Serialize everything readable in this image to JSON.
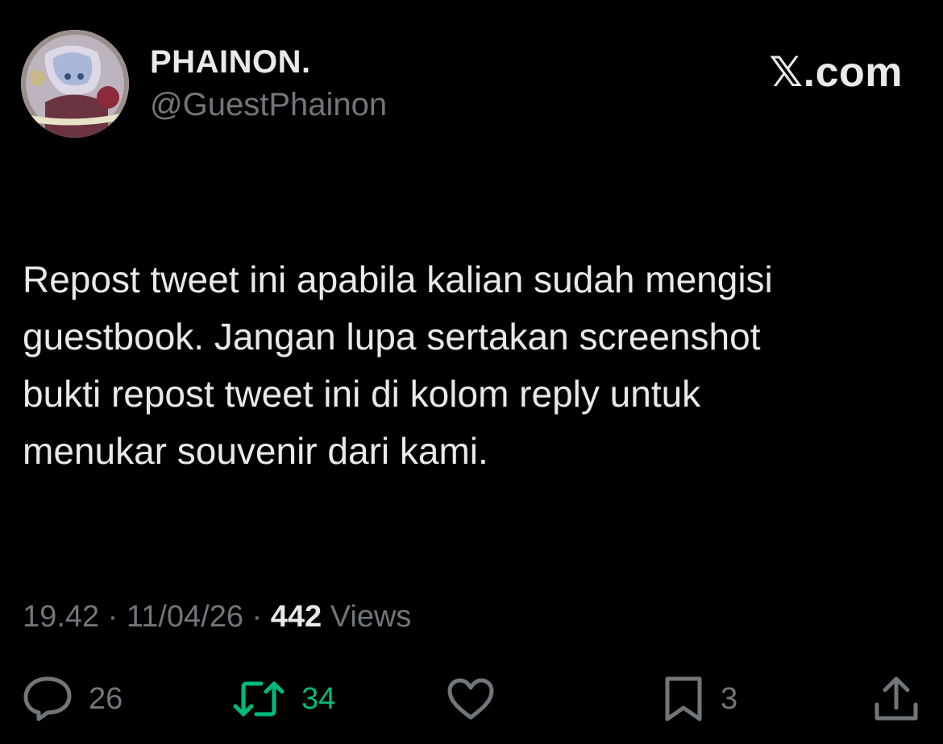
{
  "author": {
    "display_name": "PHAINON.",
    "handle": "@GuestPhainon",
    "avatar_icon": "profile-avatar"
  },
  "brand": "𝕏.com",
  "tweet": {
    "text": "Repost tweet ini apabila kalian sudah mengisi\nguestbook. Jangan lupa sertakan screenshot\nbukti repost tweet ini di kolom reply untuk\nmenukar souvenir dari kami."
  },
  "meta": {
    "time": "19.42",
    "separator": "·",
    "date": "11/04/26",
    "views_count": "442",
    "views_label": "Views"
  },
  "actions": {
    "reply": {
      "icon": "reply-icon",
      "count": "26"
    },
    "repost": {
      "icon": "repost-icon",
      "count": "34",
      "active_color": "#00ba7c"
    },
    "like": {
      "icon": "heart-icon"
    },
    "bookmark": {
      "icon": "bookmark-icon",
      "count": "3"
    },
    "share": {
      "icon": "share-icon"
    }
  },
  "colors": {
    "background": "#000000",
    "text_primary": "#e7e9ea",
    "text_secondary": "#71767b",
    "repost_active": "#00ba7c"
  }
}
